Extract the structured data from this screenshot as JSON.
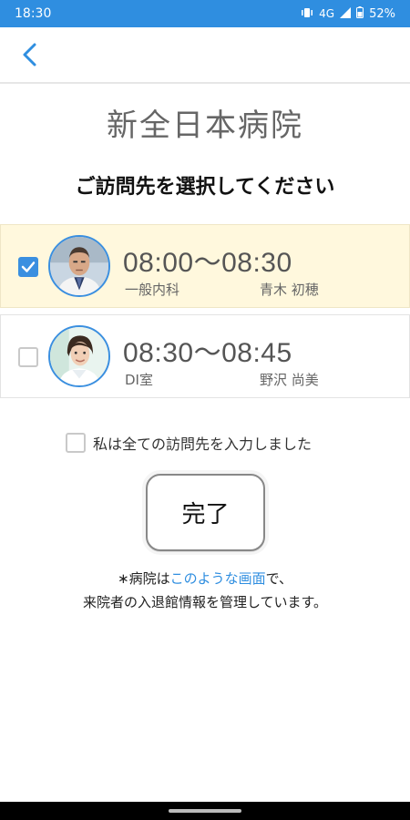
{
  "status": {
    "time": "18:30",
    "network": "4G",
    "battery": "52%"
  },
  "header": {
    "back_icon": "chevron-left-icon"
  },
  "title": "新全日本病院",
  "subtitle": "ご訪問先を選択してください",
  "visits": [
    {
      "time": "08:00〜08:30",
      "dept": "一般内科",
      "doctor": "青木 初穂",
      "selected": true
    },
    {
      "time": "08:30〜08:45",
      "dept": "DI室",
      "doctor": "野沢 尚美",
      "selected": false
    }
  ],
  "confirm_label": "私は全ての訪問先を入力しました",
  "done_label": "完了",
  "footnote": {
    "prefix": "∗病院は",
    "link": "このような画面",
    "suffix": "で、",
    "line2": "来院者の入退館情報を管理しています。"
  },
  "colors": {
    "accent": "#2f8ee0",
    "selected_bg": "#fff8dd"
  }
}
